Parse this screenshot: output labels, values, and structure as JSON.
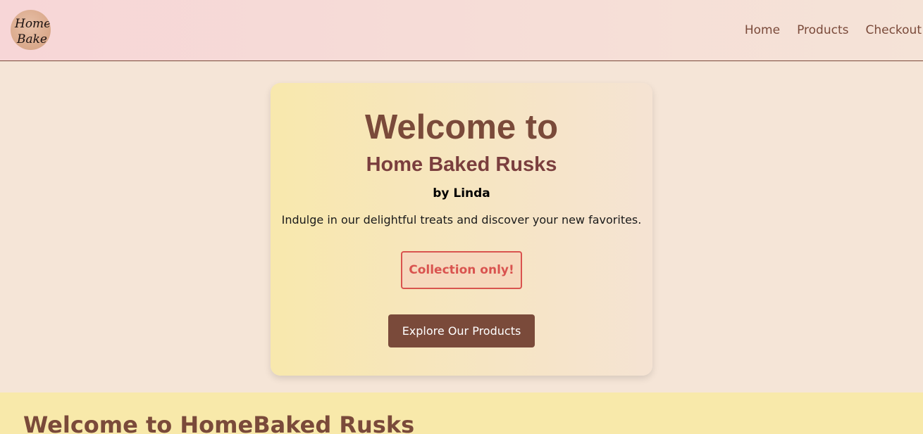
{
  "nav": {
    "logo_text": "Home Bake",
    "links": [
      {
        "label": "Home"
      },
      {
        "label": "Products"
      },
      {
        "label": "Checkout"
      }
    ]
  },
  "hero": {
    "title": "Welcome to",
    "subtitle": "Home Baked Rusks",
    "byline": "by Linda",
    "tagline": "Indulge in our delightful treats and discover your new favorites.",
    "badge": "Collection only!",
    "cta_label": "Explore Our Products"
  },
  "section": {
    "title": "Welcome to HomeBaked Rusks"
  },
  "colors": {
    "brand_brown": "#7a4a3a",
    "badge_red": "#d9534f",
    "band_yellow": "#f8e9aa",
    "page_bg": "#f5e5d7"
  }
}
